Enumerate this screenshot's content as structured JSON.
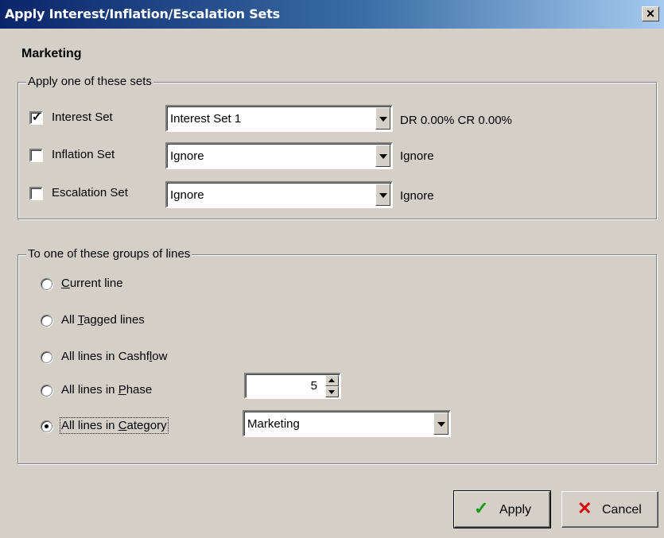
{
  "window": {
    "title": "Apply Interest/Inflation/Escalation Sets",
    "close_glyph": "✕"
  },
  "heading": "Marketing",
  "sets_group": {
    "legend": "Apply one of these sets",
    "rows": [
      {
        "label": "Interest Set",
        "checked": true,
        "value": "Interest Set 1",
        "info": "DR  0.00% CR  0.00%"
      },
      {
        "label": "Inflation Set",
        "checked": false,
        "value": "Ignore",
        "info": "Ignore"
      },
      {
        "label": "Escalation Set",
        "checked": false,
        "value": "Ignore",
        "info": "Ignore"
      }
    ]
  },
  "lines_group": {
    "legend": "To one of these groups of lines",
    "options": [
      {
        "label": "Current line",
        "selected": false
      },
      {
        "label": "All Tagged lines",
        "selected": false
      },
      {
        "label": "All lines in Cashflow",
        "selected": false
      },
      {
        "label": "All lines in Phase",
        "selected": false
      },
      {
        "label": "All lines in Category",
        "selected": true
      }
    ],
    "phase_value": "5",
    "category_value": "Marketing"
  },
  "buttons": {
    "apply": "Apply",
    "cancel": "Cancel"
  },
  "colors": {
    "apply_icon": "#119911",
    "cancel_icon": "#dd0000",
    "titlebar_start": "#0a246a",
    "titlebar_end": "#a6caf0"
  }
}
